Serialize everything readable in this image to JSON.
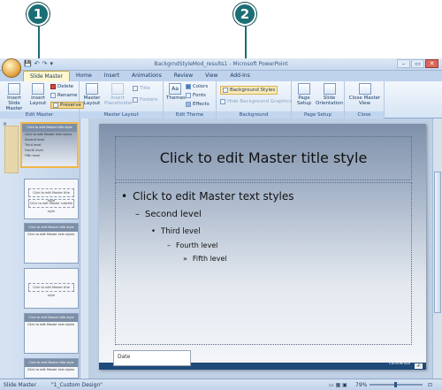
{
  "callouts": [
    "1",
    "2"
  ],
  "window": {
    "title": "BackgrndStyleMod_results1 - Microsoft PowerPoint",
    "qat": [
      "💾",
      "↶",
      "↷",
      "▾"
    ],
    "controls": [
      "–",
      "▭",
      "✕"
    ]
  },
  "tabs": [
    "Slide Master",
    "Home",
    "Insert",
    "Animations",
    "Review",
    "View",
    "Add-Ins"
  ],
  "ribbon": {
    "edit_master": {
      "label": "Edit Master",
      "insert_slide_master": "Insert Slide Master",
      "insert_layout": "Insert Layout",
      "delete": "Delete",
      "rename": "Rename",
      "preserve": "Preserve"
    },
    "master_layout": {
      "label": "Master Layout",
      "master_layout": "Master Layout",
      "insert_placeholder": "Insert Placeholder",
      "title": "Title",
      "footers": "Footers"
    },
    "edit_theme": {
      "label": "Edit Theme",
      "themes": "Themes",
      "colors": "Colors",
      "fonts": "Fonts",
      "effects": "Effects"
    },
    "background": {
      "label": "Background",
      "styles": "Background Styles",
      "hide": "Hide Background Graphics"
    },
    "page_setup": {
      "label": "Page Setup",
      "page_setup": "Page Setup",
      "orientation": "Slide Orientation"
    },
    "close": {
      "label": "Close",
      "close_master": "Close Master View"
    }
  },
  "thumbs": [
    {
      "title": "Click to edit Master title style",
      "lines": [
        "Click to edit Master text styles",
        "Second level",
        "Third level",
        "Fourth level",
        "Fifth level"
      ]
    },
    {
      "title": "Click to edit Master title style",
      "lines": [
        "Click to edit Master subtitle style"
      ]
    },
    {
      "title": "Click to edit Master title style",
      "lines": [
        "Click to edit Master text styles"
      ]
    },
    {
      "title": "",
      "lines": [
        "Click to edit Master title style"
      ]
    },
    {
      "title": "Click to edit Master title style",
      "lines": [
        "Click to edit Master text styles"
      ]
    },
    {
      "title": "Click to edit Master title style",
      "lines": [
        "Click to edit Master text styles"
      ]
    }
  ],
  "slide": {
    "title": "Click to edit Master title style",
    "levels": [
      {
        "bullet": "•",
        "text": "Click to edit Master text styles"
      },
      {
        "bullet": "–",
        "text": "Second level"
      },
      {
        "bullet": "•",
        "text": "Third level"
      },
      {
        "bullet": "–",
        "text": "Fourth level"
      },
      {
        "bullet": "»",
        "text": "Fifth level"
      }
    ],
    "date": "Date",
    "footer_text": "Confidential",
    "page_number": "‹#›"
  },
  "status": {
    "view": "Slide Master",
    "theme": "\"1_Custom Design\"",
    "zoom": "79%"
  }
}
